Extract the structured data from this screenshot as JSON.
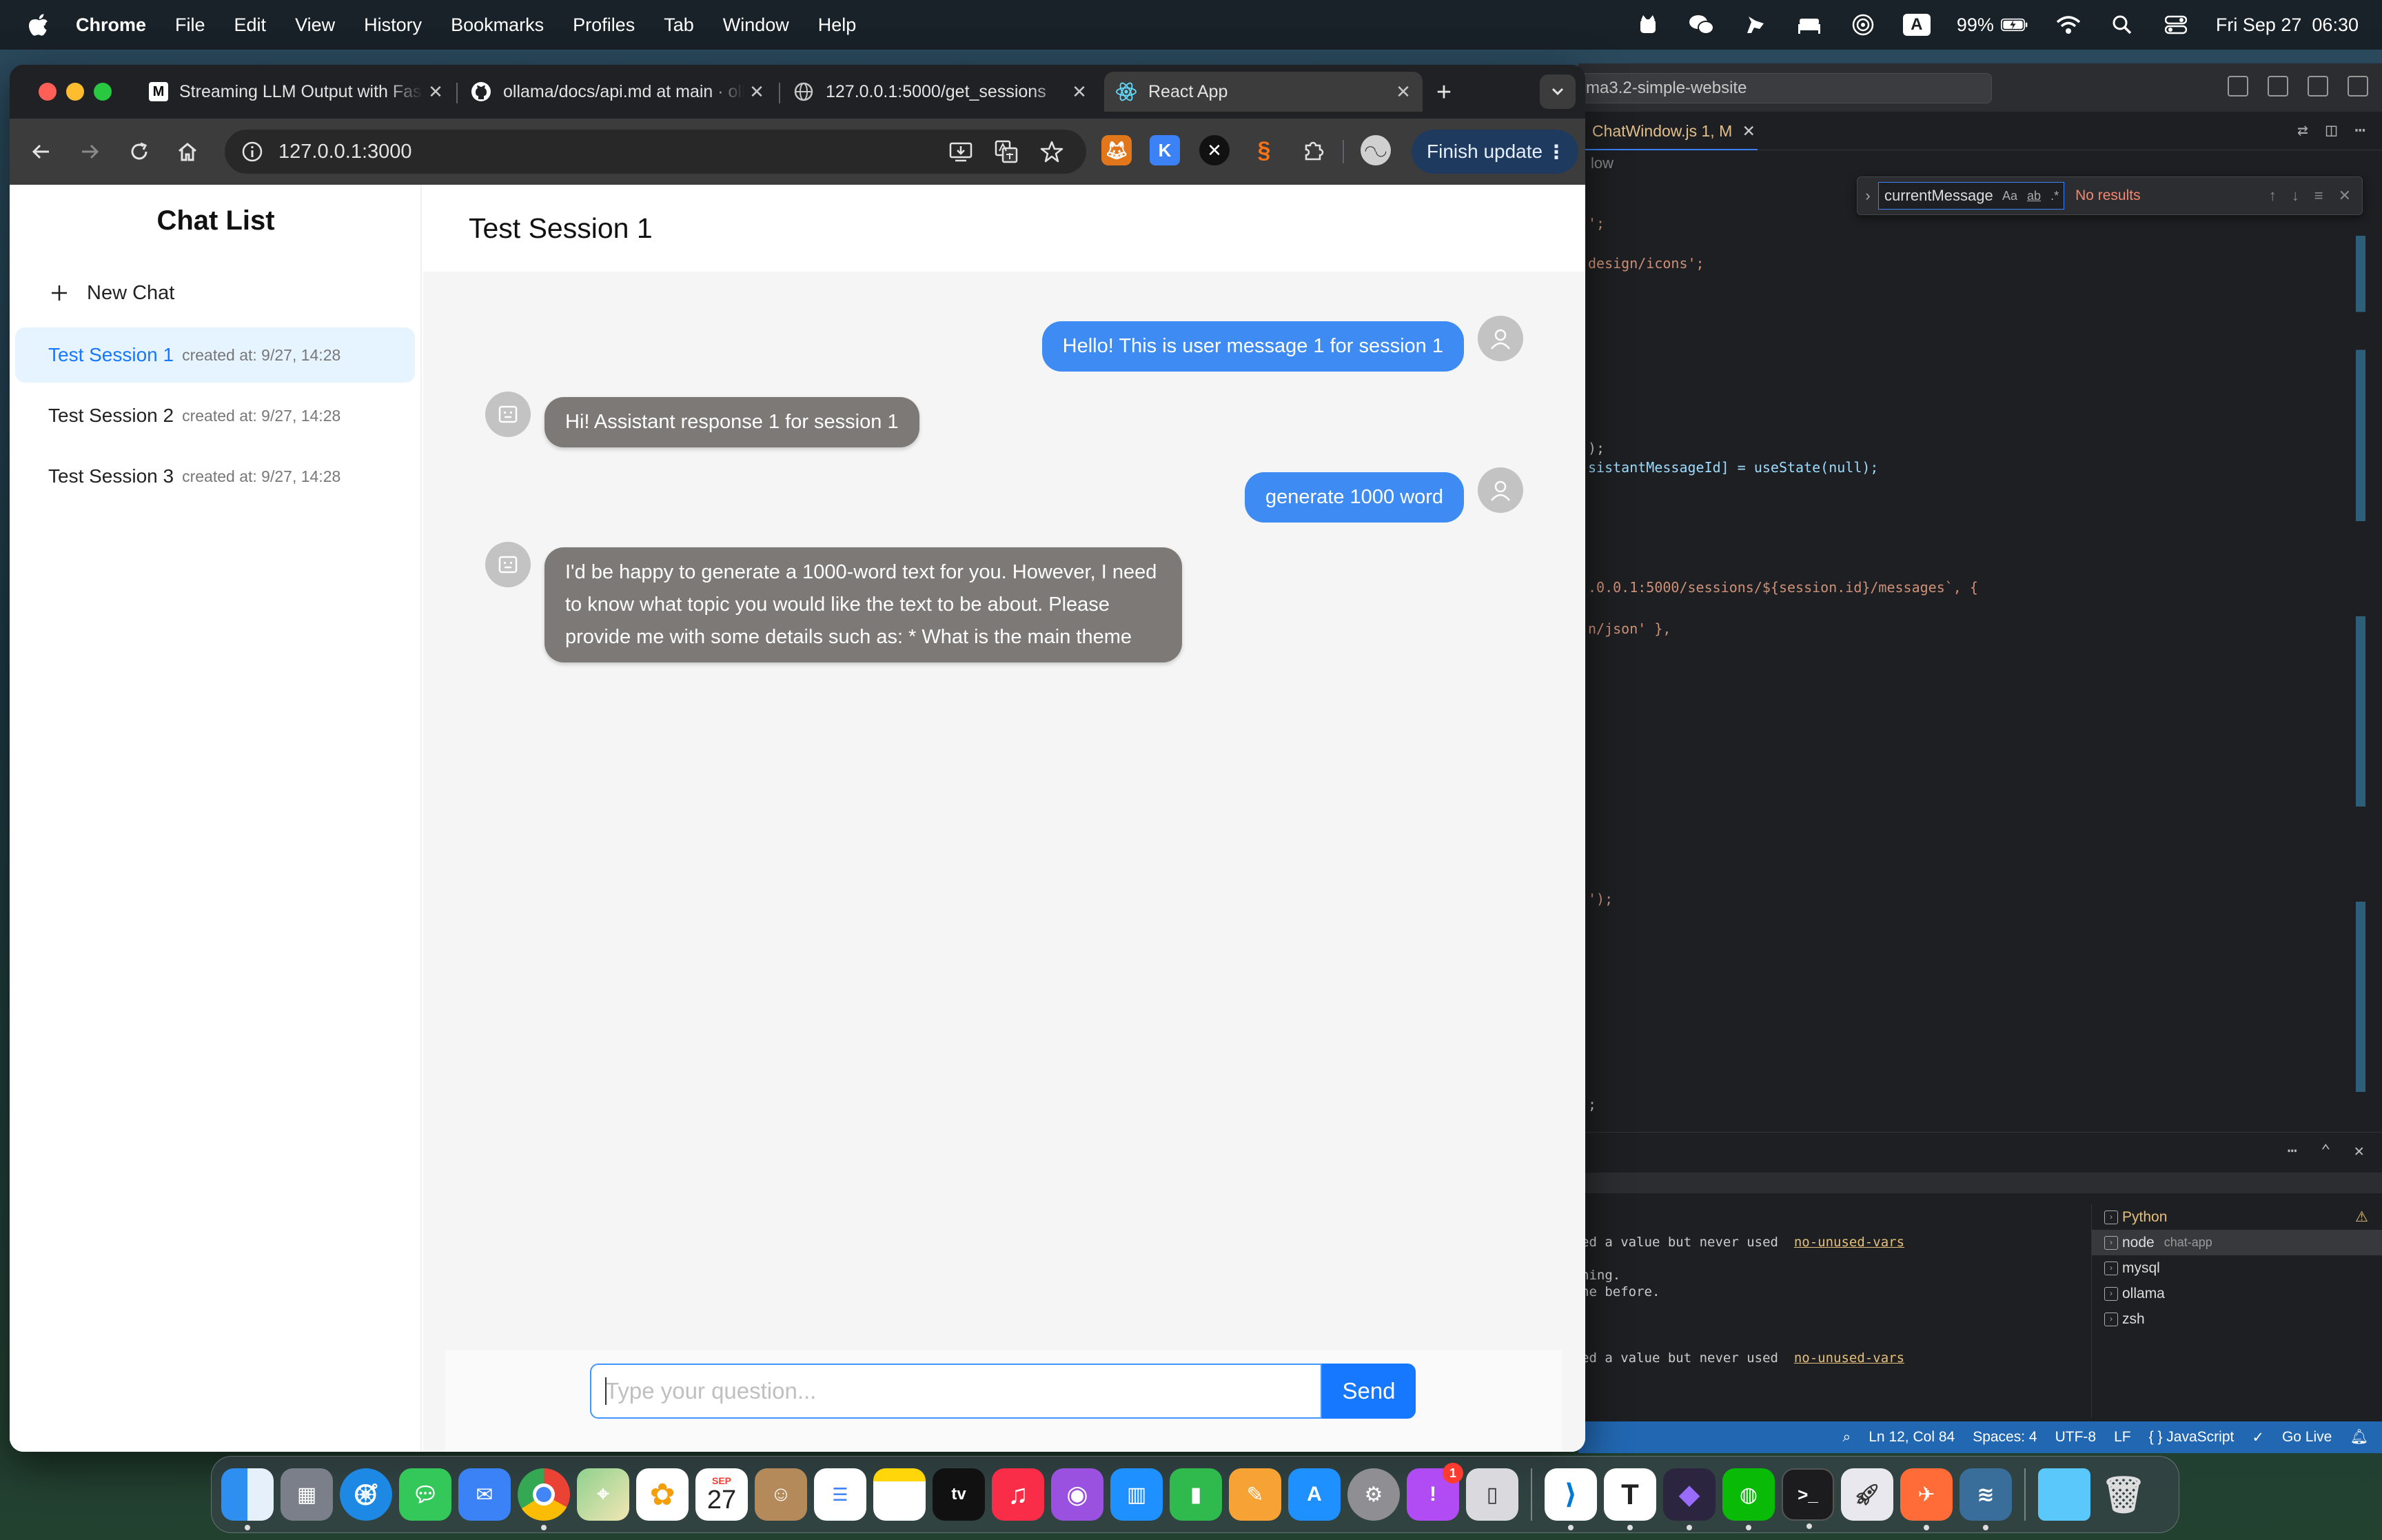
{
  "menubar": {
    "items": [
      "Chrome",
      "File",
      "Edit",
      "View",
      "History",
      "Bookmarks",
      "Profiles",
      "Tab",
      "Window",
      "Help"
    ],
    "battery": "99%",
    "datetime": "Fri Sep 27  06:30",
    "input_source": "A"
  },
  "vscode": {
    "title": "ma3.2-simple-website",
    "tab_label": "ChatWindow.js 1, M",
    "breadcrumb": "low",
    "find_value": "currentMessage",
    "find_opts": [
      "Aa",
      "ab",
      ".*"
    ],
    "find_result": "No results",
    "code_lines": [
      {
        "text": "';"
      },
      {
        "text": "design/icons';"
      },
      {
        "text": ");"
      },
      {
        "text": "sistantMessageId] = useState(null);"
      },
      {
        "text": ".0.0.1:5000/sessions/${session.id}/messages`, {"
      },
      {
        "text": "n/json' },"
      },
      {
        "text": "');"
      },
      {
        "text": ";"
      }
    ],
    "terminal_lines": [
      {
        "text": "ed a value but never used  ",
        "rule": "no-unused-vars"
      },
      {
        "text": "ning."
      },
      {
        "text": "ne before."
      },
      {
        "text": "ed a value but never used  ",
        "rule": "no-unused-vars"
      }
    ],
    "terminals": [
      {
        "name": "Python",
        "sub": ""
      },
      {
        "name": "node",
        "sub": "chat-app"
      },
      {
        "name": "mysql",
        "sub": ""
      },
      {
        "name": "ollama",
        "sub": ""
      },
      {
        "name": "zsh",
        "sub": ""
      }
    ],
    "status": {
      "position": "Ln 12, Col 84",
      "spaces": "Spaces: 4",
      "encoding": "UTF-8",
      "eol": "LF",
      "language": "{ } JavaScript",
      "golive": "Go Live"
    }
  },
  "chrome": {
    "tabs": [
      {
        "title": "Streaming LLM Output with FastAPI",
        "icon": "medium-icon"
      },
      {
        "title": "ollama/docs/api.md at main · ollama",
        "icon": "github-icon"
      },
      {
        "title": "127.0.0.1:5000/get_sessions",
        "icon": "globe-icon"
      },
      {
        "title": "React App",
        "icon": "react-icon"
      }
    ],
    "url": "127.0.0.1:3000",
    "finish_update": "Finish update"
  },
  "app": {
    "sidebar_title": "Chat List",
    "new_chat": "New Chat",
    "sessions": [
      {
        "name": "Test Session 1",
        "created": "created at: 9/27, 14:28",
        "active": true
      },
      {
        "name": "Test Session 2",
        "created": "created at: 9/27, 14:28",
        "active": false
      },
      {
        "name": "Test Session 3",
        "created": "created at: 9/27, 14:28",
        "active": false
      }
    ],
    "current_title": "Test Session 1",
    "messages": [
      {
        "role": "user",
        "text": "Hello! This is user message 1 for session 1"
      },
      {
        "role": "assistant",
        "text": "Hi! Assistant response 1 for session 1"
      },
      {
        "role": "user",
        "text": "generate 1000 word"
      },
      {
        "role": "assistant",
        "text": "I'd be happy to generate a 1000-word text for you. However, I need to know what topic you would like the text to be about. Please provide me with some details such as: * What is the main theme"
      }
    ],
    "input_placeholder": "Type your question...",
    "send_label": "Send"
  },
  "dock": {
    "calendar_month": "SEP",
    "calendar_day": "27",
    "settings_badge": "1"
  },
  "colors": {
    "user_bubble": "#3d8bf3",
    "assistant_bubble": "#7d7977",
    "active_session_bg": "#e6f4ff",
    "primary": "#1677ff"
  }
}
